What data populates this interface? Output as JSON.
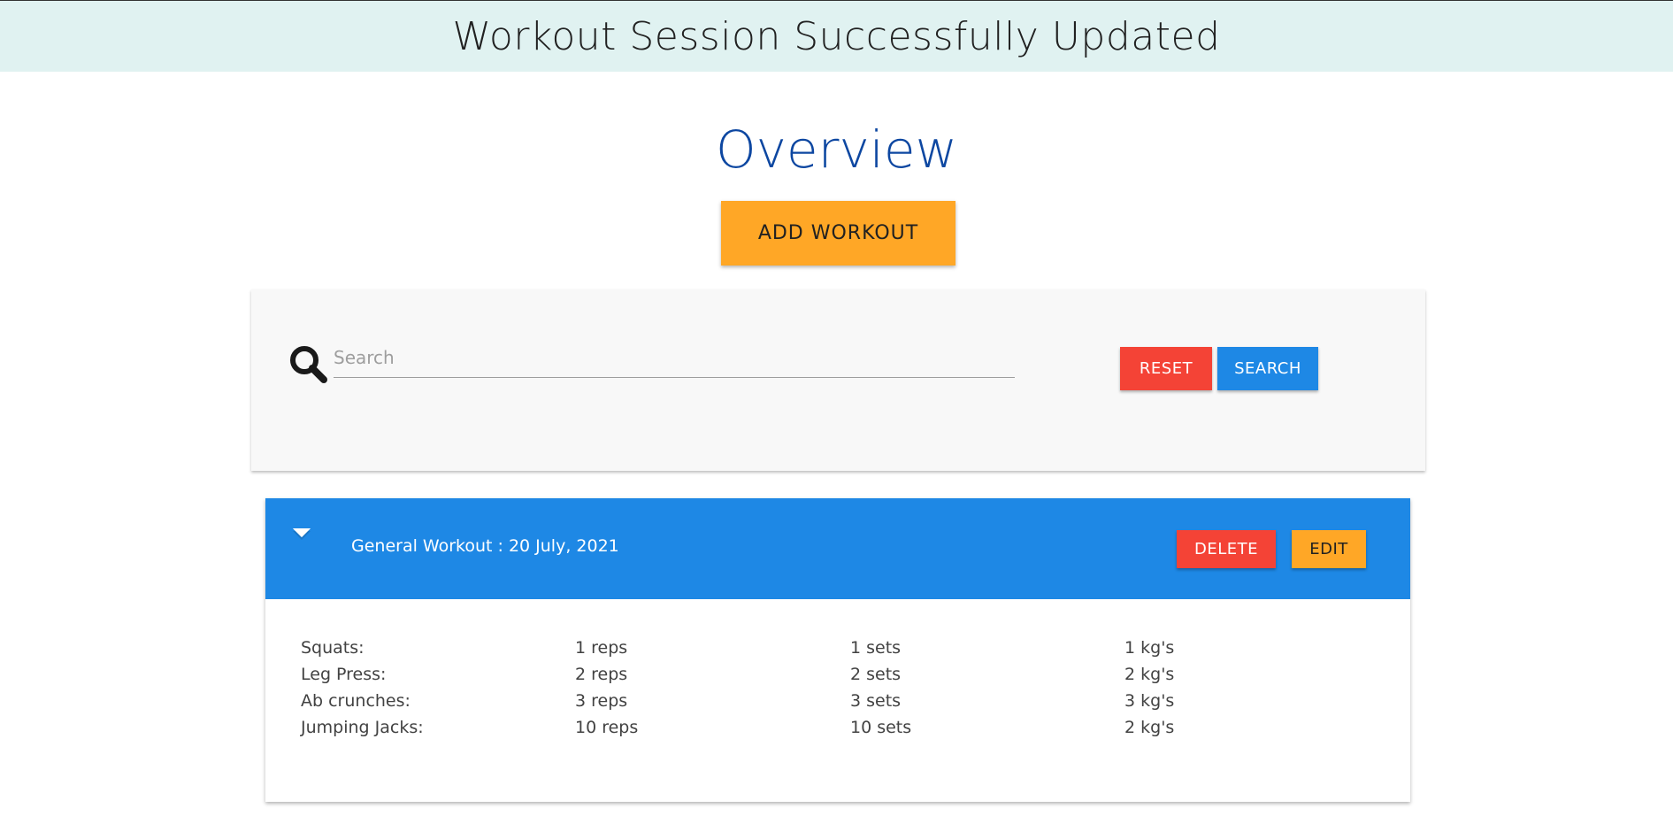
{
  "flash": {
    "message": "Workout Session Successfully Updated"
  },
  "page": {
    "title": "Overview"
  },
  "actions": {
    "add_workout_label": "ADD WORKOUT"
  },
  "search": {
    "placeholder": "Search",
    "value": "",
    "reset_label": "RESET",
    "search_label": "SEARCH"
  },
  "workout": {
    "title": "General Workout : 20 July, 2021",
    "delete_label": "DELETE",
    "edit_label": "EDIT",
    "exercises": [
      {
        "name": "Squats:",
        "reps": "1 reps",
        "sets": "1 sets",
        "weight": "1 kg's"
      },
      {
        "name": "Leg Press:",
        "reps": "2 reps",
        "sets": "2 sets",
        "weight": "2 kg's"
      },
      {
        "name": "Ab crunches:",
        "reps": "3 reps",
        "sets": "3 sets",
        "weight": "3 kg's"
      },
      {
        "name": "Jumping Jacks:",
        "reps": "10 reps",
        "sets": "10 sets",
        "weight": "2 kg's"
      }
    ]
  },
  "colors": {
    "flash_bg": "#e0f2f1",
    "title": "#0d47a1",
    "primary": "#1e88e5",
    "danger": "#f44336",
    "accent": "#ffa726"
  },
  "icons": {
    "search": "search-icon",
    "expand": "caret-down-icon"
  }
}
